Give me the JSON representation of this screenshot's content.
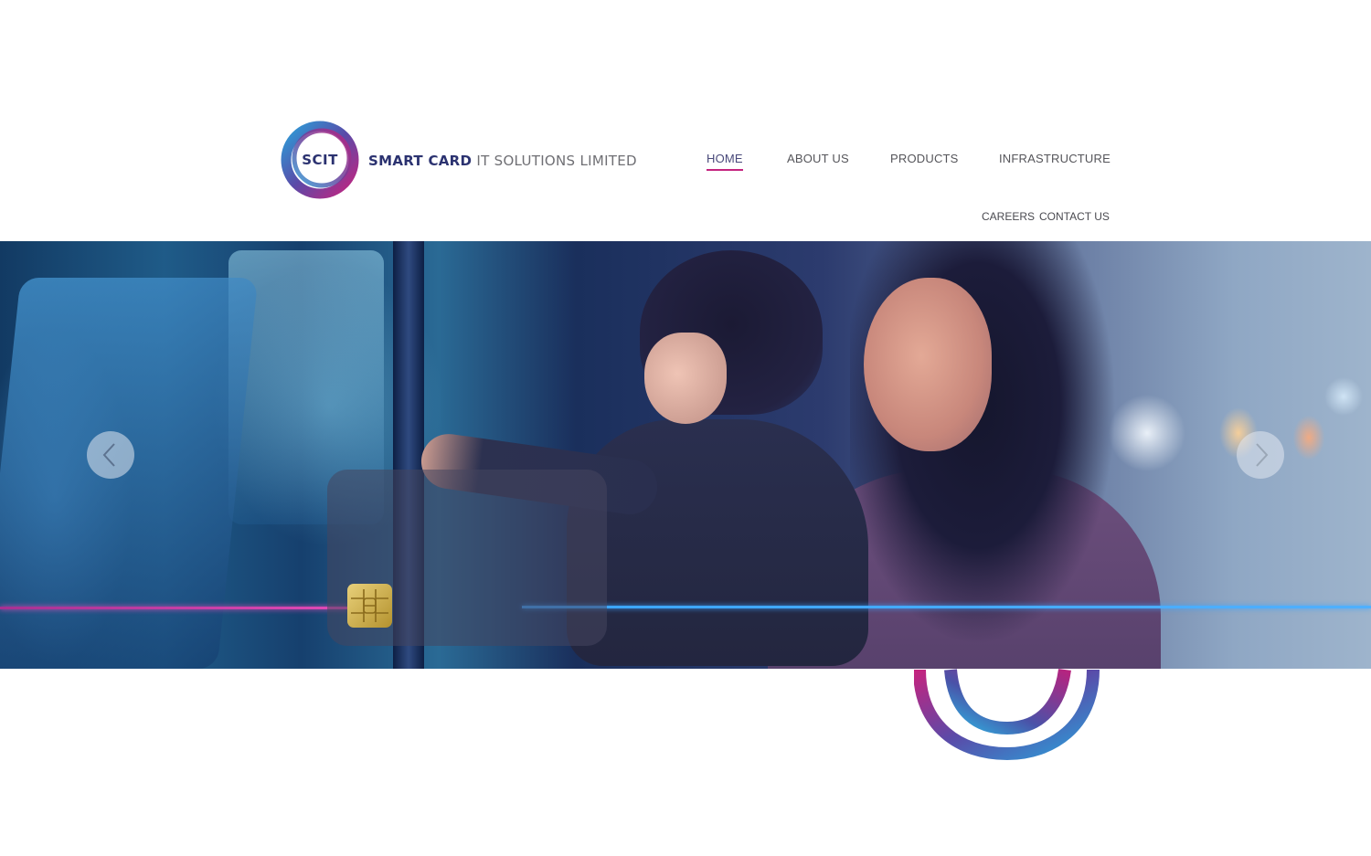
{
  "brand": {
    "mark_text": "SCIT",
    "name_bold": "SMART CARD",
    "name_light": "IT SOLUTIONS LIMITED"
  },
  "nav": {
    "items": [
      {
        "label": "HOME",
        "active": true
      },
      {
        "label": "ABOUT US",
        "active": false
      },
      {
        "label": "PRODUCTS",
        "active": false
      },
      {
        "label": "INFRASTRUCTURE",
        "active": false
      }
    ],
    "secondary": [
      {
        "label": "CAREERS"
      },
      {
        "label": "CONTACT US"
      }
    ]
  },
  "slider": {
    "prev_icon": "chevron-left-icon",
    "next_icon": "chevron-right-icon"
  },
  "colors": {
    "brand_navy": "#2b3270",
    "accent_magenta": "#c4247f",
    "accent_blue": "#3aa4ff"
  }
}
